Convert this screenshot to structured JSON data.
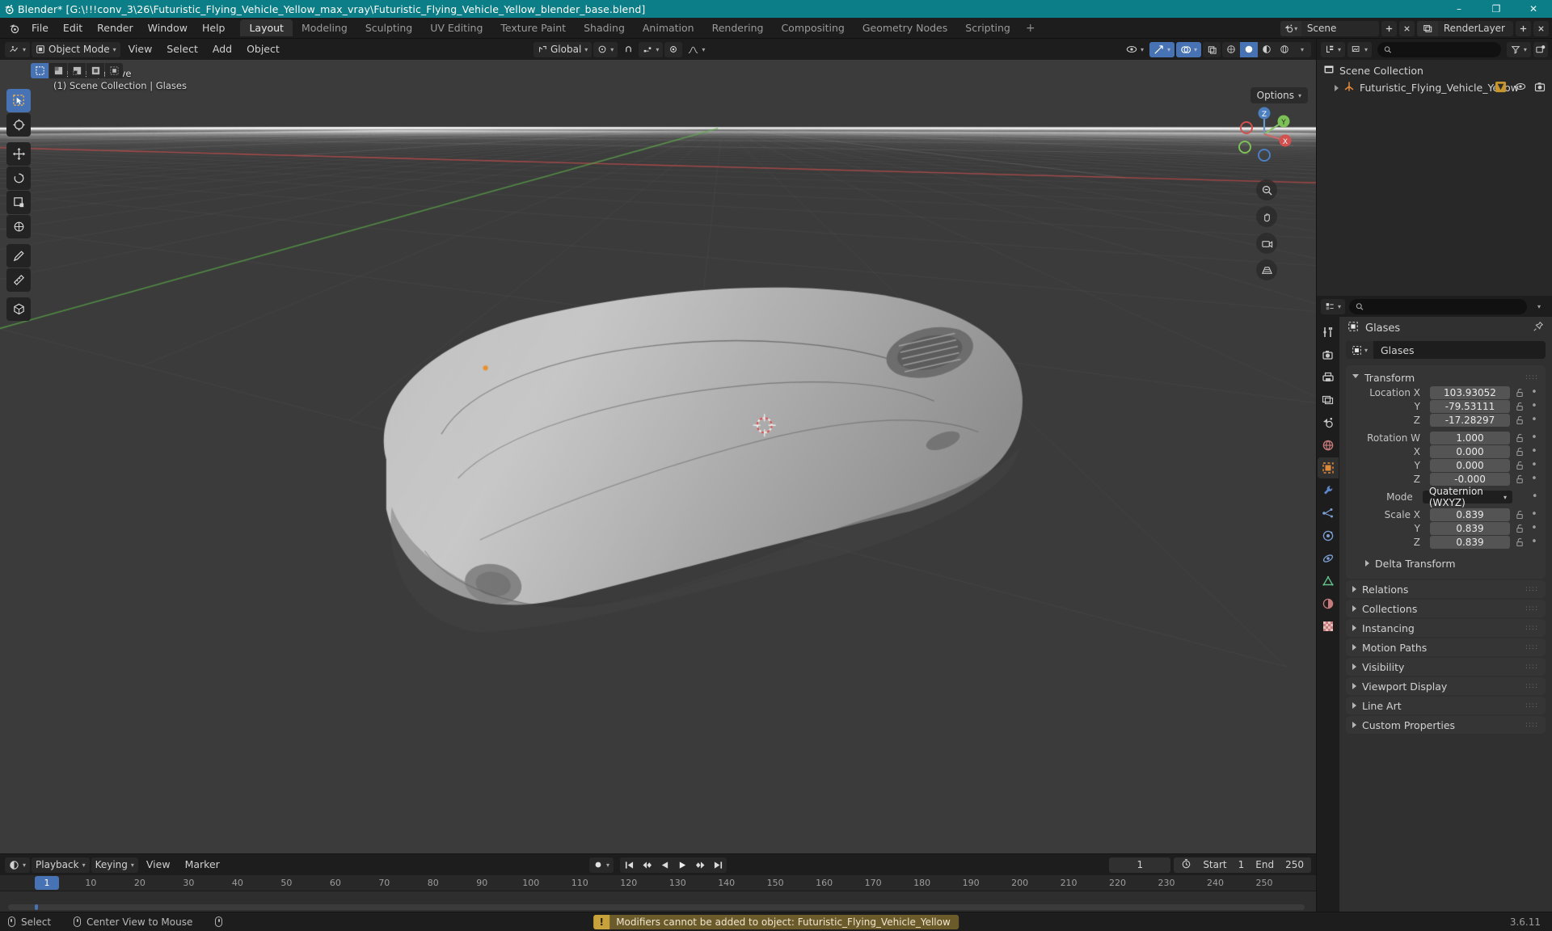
{
  "window": {
    "title": "Blender* [G:\\!!!conv_3\\26\\Futuristic_Flying_Vehicle_Yellow_max_vray\\Futuristic_Flying_Vehicle_Yellow_blender_base.blend]",
    "minimize": "–",
    "maximize": "❐",
    "close": "✕",
    "titlebar_color": "#0b7e87"
  },
  "topbar": {
    "menus": [
      "File",
      "Edit",
      "Render",
      "Window",
      "Help"
    ],
    "workspaces": [
      "Layout",
      "Modeling",
      "Sculpting",
      "UV Editing",
      "Texture Paint",
      "Shading",
      "Animation",
      "Rendering",
      "Compositing",
      "Geometry Nodes",
      "Scripting"
    ],
    "active_workspace": "Layout",
    "add_workspace": "+",
    "scene_name": "Scene",
    "view_layer_name": "RenderLayer"
  },
  "viewport": {
    "mode": "Object Mode",
    "menus": [
      "View",
      "Select",
      "Add",
      "Object"
    ],
    "transform_orientation": "Global",
    "overlay_line1": "User Perspective",
    "overlay_line2": "(1) Scene Collection | Glases",
    "options_label": "Options",
    "gizmo_axes": [
      "X",
      "Y",
      "Z"
    ],
    "tools": [
      "tweak-select-tool",
      "cursor-tool",
      "move-tool",
      "rotate-tool",
      "scale-tool",
      "transform-tool",
      "annotate-tool",
      "measure-tool",
      "add-cube-tool"
    ],
    "active_tool": "tweak-select-tool"
  },
  "outliner": {
    "search_placeholder": "",
    "rows": [
      {
        "label": "Scene Collection",
        "icon": "collection-icon",
        "indent": 0
      },
      {
        "label": "Futuristic_Flying_Vehicle_Yellow",
        "icon": "empty-axis-icon",
        "indent": 1
      }
    ]
  },
  "properties": {
    "search_placeholder": "",
    "breadcrumb": "Glases",
    "object_name": "Glases",
    "transform": {
      "title": "Transform",
      "location_label": "Location X",
      "location_axes": [
        "Y",
        "Z"
      ],
      "location": [
        "103.93052",
        "-79.53111",
        "-17.28297"
      ],
      "rotation_label": "Rotation W",
      "rotation_axes": [
        "X",
        "Y",
        "Z"
      ],
      "rotation": [
        "1.000",
        "0.000",
        "0.000",
        "-0.000"
      ],
      "mode_label": "Mode",
      "mode_value": "Quaternion (WXYZ)",
      "scale_label": "Scale X",
      "scale_axes": [
        "Y",
        "Z"
      ],
      "scale": [
        "0.839",
        "0.839",
        "0.839"
      ]
    },
    "panels": [
      "Delta Transform",
      "Relations",
      "Collections",
      "Instancing",
      "Motion Paths",
      "Visibility",
      "Viewport Display",
      "Line Art",
      "Custom Properties"
    ],
    "tabs": [
      "tool-tab",
      "render-tab",
      "output-tab",
      "view-layer-tab",
      "scene-tab",
      "world-tab",
      "object-tab",
      "modifier-tab",
      "particles-tab",
      "physics-tab",
      "constraints-tab",
      "data-tab",
      "material-tab",
      "texture-tab"
    ],
    "active_tab": "object-tab"
  },
  "timeline": {
    "editor_menu": "playback-mode",
    "menus": [
      "Playback",
      "Keying",
      "View",
      "Marker"
    ],
    "current_frame": "1",
    "start_label": "Start",
    "start_value": "1",
    "end_label": "End",
    "end_value": "250",
    "ticks": [
      "10",
      "20",
      "30",
      "40",
      "50",
      "60",
      "70",
      "80",
      "90",
      "100",
      "110",
      "120",
      "130",
      "140",
      "150",
      "160",
      "170",
      "180",
      "190",
      "200",
      "210",
      "220",
      "230",
      "240",
      "250"
    ],
    "playhead_frame": "1"
  },
  "statusbar": {
    "items": [
      {
        "icon": "mouse-left-icon",
        "label": "Select"
      },
      {
        "icon": "mouse-middle-icon",
        "label": "Center View to Mouse"
      },
      {
        "icon": "mouse-right-icon",
        "label": ""
      }
    ],
    "report": "Modifiers cannot be added to object: Futuristic_Flying_Vehicle_Yellow",
    "report_icon": "warning-icon",
    "version": "3.6.11"
  }
}
